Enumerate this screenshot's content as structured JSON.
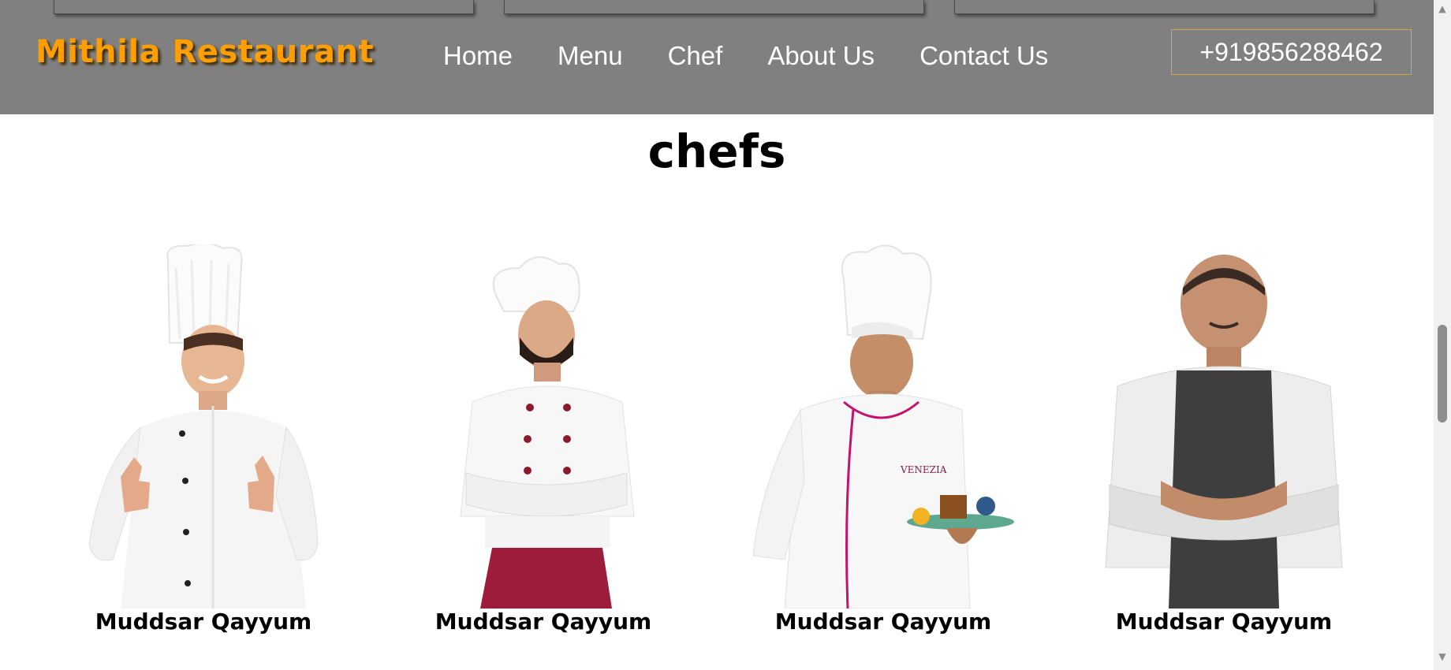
{
  "header": {
    "brand": "Mithila Restaurant",
    "nav": [
      "Home",
      "Menu",
      "Chef",
      "About Us",
      "Contact Us"
    ],
    "phone": "+919856288462"
  },
  "section": {
    "title": "chefs"
  },
  "chefs": [
    {
      "name": "Muddsar Qayyum"
    },
    {
      "name": "Muddsar Qayyum"
    },
    {
      "name": "Muddsar Qayyum"
    },
    {
      "name": "Muddsar Qayyum"
    }
  ],
  "colors": {
    "header_bg": "#808080",
    "brand": "#ff9e00",
    "phone_border": "#d6a53a",
    "apron_red": "#9d1c3a",
    "apron_gray": "#3e3e3e"
  },
  "scrollbar": {
    "up_icon": "chevron-up-icon",
    "down_icon": "chevron-down-icon"
  }
}
